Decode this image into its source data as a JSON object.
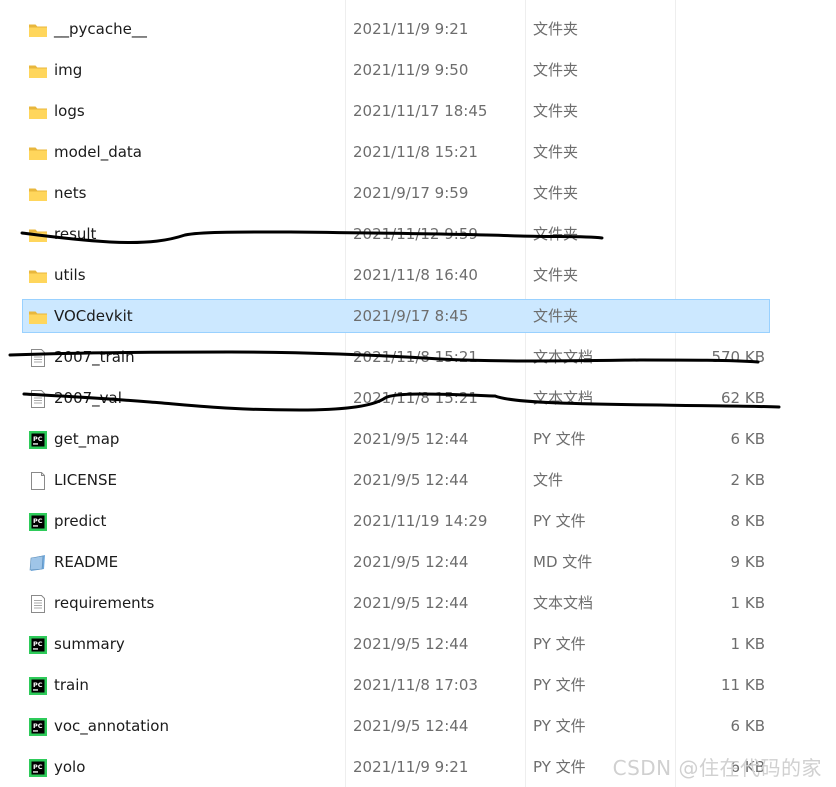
{
  "files": [
    {
      "name": "__pycache__",
      "date": "2021/11/9 9:21",
      "type": "文件夹",
      "size": "",
      "icon": "folder-icon"
    },
    {
      "name": "img",
      "date": "2021/11/9 9:50",
      "type": "文件夹",
      "size": "",
      "icon": "folder-icon"
    },
    {
      "name": "logs",
      "date": "2021/11/17 18:45",
      "type": "文件夹",
      "size": "",
      "icon": "folder-icon"
    },
    {
      "name": "model_data",
      "date": "2021/11/8 15:21",
      "type": "文件夹",
      "size": "",
      "icon": "folder-icon"
    },
    {
      "name": "nets",
      "date": "2021/9/17 9:59",
      "type": "文件夹",
      "size": "",
      "icon": "folder-icon"
    },
    {
      "name": "result",
      "date": "2021/11/12 9:59",
      "type": "文件夹",
      "size": "",
      "icon": "folder-icon"
    },
    {
      "name": "utils",
      "date": "2021/11/8 16:40",
      "type": "文件夹",
      "size": "",
      "icon": "folder-icon"
    },
    {
      "name": "VOCdevkit",
      "date": "2021/9/17 8:45",
      "type": "文件夹",
      "size": "",
      "icon": "folder-icon",
      "selected": true
    },
    {
      "name": "2007_train",
      "date": "2021/11/8 15:21",
      "type": "文本文档",
      "size": "570 KB",
      "icon": "text-file-icon"
    },
    {
      "name": "2007_val",
      "date": "2021/11/8 15:21",
      "type": "文本文档",
      "size": "62 KB",
      "icon": "text-file-icon"
    },
    {
      "name": "get_map",
      "date": "2021/9/5 12:44",
      "type": "PY 文件",
      "size": "6 KB",
      "icon": "pycharm-file-icon"
    },
    {
      "name": "LICENSE",
      "date": "2021/9/5 12:44",
      "type": "文件",
      "size": "2 KB",
      "icon": "blank-file-icon"
    },
    {
      "name": "predict",
      "date": "2021/11/19 14:29",
      "type": "PY 文件",
      "size": "8 KB",
      "icon": "pycharm-file-icon"
    },
    {
      "name": "README",
      "date": "2021/9/5 12:44",
      "type": "MD 文件",
      "size": "9 KB",
      "icon": "markdown-file-icon"
    },
    {
      "name": "requirements",
      "date": "2021/9/5 12:44",
      "type": "文本文档",
      "size": "1 KB",
      "icon": "text-file-icon"
    },
    {
      "name": "summary",
      "date": "2021/9/5 12:44",
      "type": "PY 文件",
      "size": "1 KB",
      "icon": "pycharm-file-icon"
    },
    {
      "name": "train",
      "date": "2021/11/8 17:03",
      "type": "PY 文件",
      "size": "11 KB",
      "icon": "pycharm-file-icon"
    },
    {
      "name": "voc_annotation",
      "date": "2021/9/5 12:44",
      "type": "PY 文件",
      "size": "6 KB",
      "icon": "pycharm-file-icon"
    },
    {
      "name": "yolo",
      "date": "2021/11/9 9:21",
      "type": "PY 文件",
      "size": "6 KB",
      "icon": "pycharm-file-icon"
    }
  ],
  "watermark": "CSDN @住在代码的家"
}
